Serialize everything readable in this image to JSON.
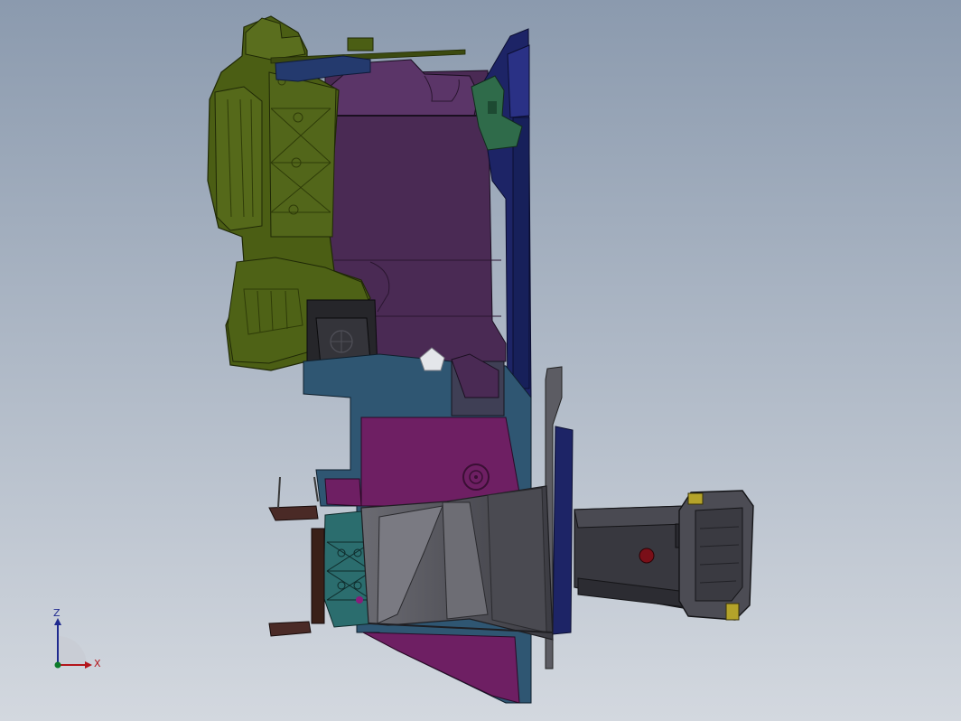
{
  "viewport": {
    "background_top": "#8b9aae",
    "background_bottom": "#d3d8df"
  },
  "model": {
    "colors": {
      "olive": "#4b5e14",
      "olive_dark": "#2f3c08",
      "purple": "#4a2a54",
      "purple_dark": "#2e1838",
      "magenta": "#6e1f63",
      "navy": "#1d2466",
      "teal": "#2b6d6e",
      "green_bracket": "#2f6b4a",
      "steel_blue": "#2f5672",
      "gray_duct": "#5a5a60",
      "gray_light": "#7b7b82",
      "dark_gray": "#38383f",
      "black_block": "#26262a",
      "yellow_clip": "#b4a32a",
      "red_marker": "#7a0f18"
    }
  },
  "triad": {
    "z_label": "Z",
    "x_label": "X",
    "colors": {
      "z": "#1f2a8f",
      "x": "#b3151b",
      "y": "#0c7a2a"
    }
  }
}
